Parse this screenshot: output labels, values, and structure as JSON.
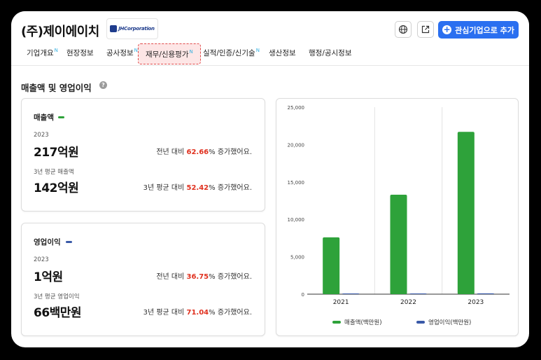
{
  "company": {
    "name": "(주)제이에이치",
    "logo_text": "JHCorporation"
  },
  "actions": {
    "globe_icon": "globe-icon",
    "share_icon": "external-link-icon",
    "add_label": "관심기업으로 추가"
  },
  "tabs": [
    {
      "label": "기업개요",
      "badge": "N"
    },
    {
      "label": "현장정보",
      "badge": ""
    },
    {
      "label": "공사정보",
      "badge": "N"
    },
    {
      "label": "재무/신용평가",
      "badge": "N",
      "active": true
    },
    {
      "label": "실적/인증/신기술",
      "badge": "N"
    },
    {
      "label": "생산정보",
      "badge": ""
    },
    {
      "label": "행정/공시정보",
      "badge": ""
    }
  ],
  "section": {
    "title": "매출액 및 영업이익"
  },
  "revenue": {
    "title": "매출액",
    "color": "#2ea23a",
    "year_label": "2023",
    "year_value": "217억원",
    "yoy_prefix": "전년 대비 ",
    "yoy_pct": "62.66",
    "yoy_suffix": "% 증가했어요.",
    "avg_label": "3년 평균 매출액",
    "avg_value": "142억원",
    "avg_prefix": "3년 평균 대비 ",
    "avg_pct": "52.42",
    "avg_suffix": "% 증가했어요."
  },
  "operating": {
    "title": "영업이익",
    "color": "#3a5aa8",
    "year_label": "2023",
    "year_value": "1억원",
    "yoy_prefix": "전년 대비 ",
    "yoy_pct": "36.75",
    "yoy_suffix": "% 증가했어요.",
    "avg_label": "3년 평균 영업이익",
    "avg_value": "66백만원",
    "avg_prefix": "3년 평균 대비 ",
    "avg_pct": "71.04",
    "avg_suffix": "% 증가했어요."
  },
  "chart_data": {
    "type": "bar",
    "categories": [
      "2021",
      "2022",
      "2023"
    ],
    "series": [
      {
        "name": "매출액(백만원)",
        "color": "#2ea23a",
        "values": [
          7600,
          13300,
          21700
        ]
      },
      {
        "name": "영업이익(백만원)",
        "color": "#3a5aa8",
        "values": [
          40,
          60,
          100
        ]
      }
    ],
    "ylim": [
      0,
      25000
    ],
    "yticks": [
      "0",
      "5,000",
      "10,000",
      "15,000",
      "20,000",
      "25,000"
    ],
    "legend": "bottom"
  }
}
